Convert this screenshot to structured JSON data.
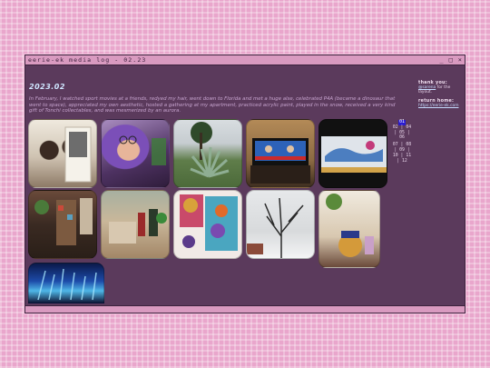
{
  "window": {
    "title": "eerie-ek media log - 02.23",
    "controls": [
      "_",
      "□",
      "×"
    ]
  },
  "main": {
    "heading": "2023.02",
    "description": "In February, I watched sport movies at a friends, redyed my hair, went down to Florida and met a huge alse, celebrated P4A (became a dinosaur that went to space), appreciated my own aesthetic, hosted a gathering at my apartment, practiced acrylic paint, played in the snow, received a very kind gift of Tonchi collectables, and was mesmerized by an aurora."
  },
  "sidebar": {
    "thanks_label": "thank you:",
    "thanks_link": "@sarena",
    "thanks_suffix": " for the layout.",
    "return_label": "return home:",
    "return_link": "https://eerie-ek.com"
  },
  "pager": {
    "rows": [
      [
        "|",
        "|"
      ],
      [
        "02",
        "|",
        "04"
      ],
      [
        "|",
        "05",
        "|"
      ],
      [
        "06"
      ],
      [
        "07",
        "|",
        "08"
      ],
      [
        "|",
        "09",
        "|"
      ],
      [
        "10",
        "|",
        "11"
      ],
      [
        "|",
        "12"
      ]
    ],
    "active": "01"
  },
  "gallery": {
    "photos": [
      {
        "name": "photo-friends-viewing-prints",
        "subject": "people viewing photos"
      },
      {
        "name": "photo-purple-hair-selfie",
        "subject": "purple hair selfie"
      },
      {
        "name": "photo-florida-agave-plant",
        "subject": "agave plant under tree"
      },
      {
        "name": "photo-tv-news-broadcast",
        "subject": "tv screen"
      },
      {
        "name": "photo-dinosaur-poster",
        "subject": "dinosaur poster"
      },
      {
        "name": "photo-cluttered-shelf-room",
        "subject": "shelf room"
      },
      {
        "name": "photo-tabletop-figures",
        "subject": "tabletop figures"
      },
      {
        "name": "photo-acrylic-paintings",
        "subject": "paintings"
      },
      {
        "name": "photo-snowy-tree",
        "subject": "snowy tree"
      },
      {
        "name": "photo-tonchi-collectables",
        "subject": "collectables"
      },
      {
        "name": "photo-aurora-screen",
        "subject": "aurora"
      }
    ]
  },
  "colors": {
    "page_background": "#e9a6cc",
    "window_background": "#5b3a5c",
    "titlebar": "#d99ac0",
    "heading": "#cfe6ff",
    "description": "#c7a4cf",
    "pager_active": "#2a1bd0"
  }
}
